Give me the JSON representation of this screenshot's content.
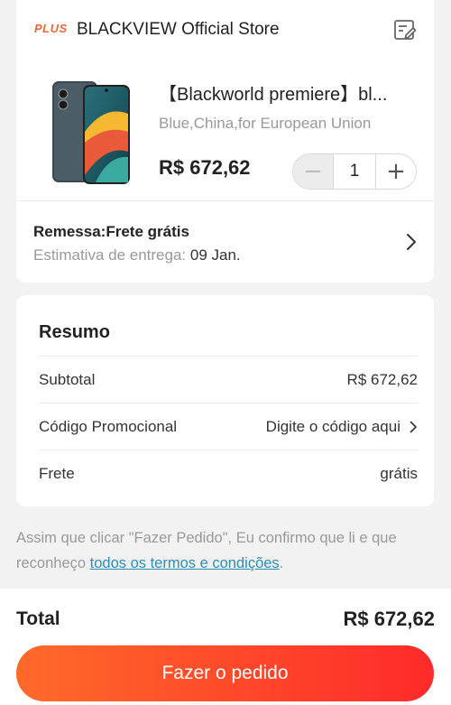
{
  "store": {
    "badge": "PLUS",
    "name": "BLACKVIEW Official Store",
    "edit_icon": "edit-note-icon"
  },
  "product": {
    "title": "【Blackworld premiere】bl...",
    "variant": "Blue,China,for European Union",
    "price": "R$ 672,62",
    "quantity": "1",
    "minus_label": "−",
    "plus_label": "+"
  },
  "shipping": {
    "title": "Remessa:Frete grátis",
    "estimate_label": "Estimativa de entrega:",
    "estimate_date": "09 Jan."
  },
  "summary": {
    "title": "Resumo",
    "rows": [
      {
        "label": "Subtotal",
        "value": "R$ 672,62"
      },
      {
        "label": "Código Promocional",
        "value": "Digite o código aqui"
      },
      {
        "label": "Frete",
        "value": "grátis"
      }
    ]
  },
  "terms": {
    "text": "Assim que clicar \"Fazer Pedido\", Eu confirmo que li e que reconheço ",
    "link": "todos os termos e condições",
    "end": "."
  },
  "footer": {
    "total_label": "Total",
    "total_value": "R$ 672,62",
    "order_button": "Fazer o pedido"
  },
  "colors": {
    "accent_start": "#ff6a2a",
    "accent_end": "#ff2a2a",
    "link": "#2a8fb8",
    "plus_badge": "#e8683a"
  }
}
